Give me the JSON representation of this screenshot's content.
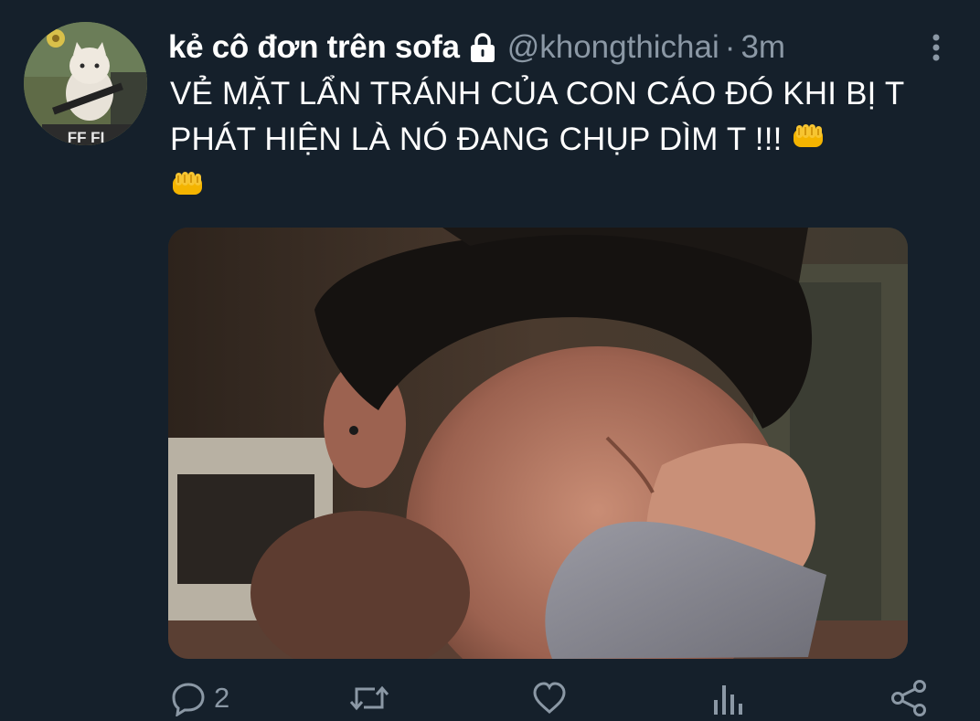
{
  "tweet": {
    "display_name": "kẻ cô đơn trên sofa",
    "handle": "@khongthichai",
    "separator": "·",
    "time": "3m",
    "text": "VẺ MẶT LẨN TRÁNH CỦA CON CÁO ĐÓ KHI BỊ T PHÁT HIỆN LÀ NÓ ĐANG CHỤP DÌM T !!!",
    "avatar_text": "FF FI"
  },
  "actions": {
    "reply_count": "2"
  },
  "icons": {
    "lock": "lock-icon",
    "more": "more-vertical-icon",
    "reply": "reply-icon",
    "retweet": "retweet-icon",
    "like": "heart-icon",
    "analytics": "analytics-icon",
    "share": "share-icon",
    "emoji": "fist-emoji"
  },
  "colors": {
    "background": "#15202b",
    "primary_text": "#ffffff",
    "secondary_text": "#8b98a5"
  }
}
